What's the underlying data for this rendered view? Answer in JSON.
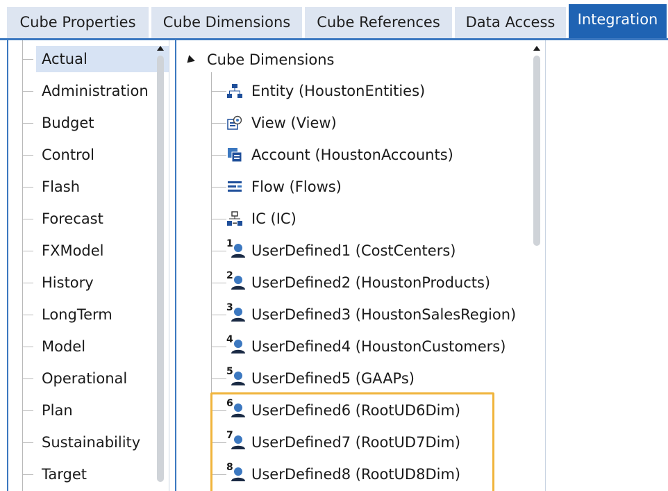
{
  "tabs": [
    {
      "label": "Cube Properties"
    },
    {
      "label": "Cube Dimensions"
    },
    {
      "label": "Cube References"
    },
    {
      "label": "Data Access"
    },
    {
      "label": "Integration"
    }
  ],
  "active_tab": "Integration",
  "scenario_types": [
    {
      "label": "Actual"
    },
    {
      "label": "Administration"
    },
    {
      "label": "Budget"
    },
    {
      "label": "Control"
    },
    {
      "label": "Flash"
    },
    {
      "label": "Forecast"
    },
    {
      "label": "FXModel"
    },
    {
      "label": "History"
    },
    {
      "label": "LongTerm"
    },
    {
      "label": "Model"
    },
    {
      "label": "Operational"
    },
    {
      "label": "Plan"
    },
    {
      "label": "Sustainability"
    },
    {
      "label": "Target"
    }
  ],
  "selected_scenario_type": "Actual",
  "dimension_tree": {
    "root_label": "Cube Dimensions",
    "items": [
      {
        "label": "Entity  (HoustonEntities)",
        "icon": "entity-icon"
      },
      {
        "label": "View  (View)",
        "icon": "view-icon"
      },
      {
        "label": "Account  (HoustonAccounts)",
        "icon": "account-icon"
      },
      {
        "label": "Flow  (Flows)",
        "icon": "flow-icon"
      },
      {
        "label": "IC  (IC)",
        "icon": "ic-icon"
      },
      {
        "label": "UserDefined1  (CostCenters)",
        "icon": "user-defined-icon",
        "num": "1"
      },
      {
        "label": "UserDefined2  (HoustonProducts)",
        "icon": "user-defined-icon",
        "num": "2"
      },
      {
        "label": "UserDefined3  (HoustonSalesRegion)",
        "icon": "user-defined-icon",
        "num": "3"
      },
      {
        "label": "UserDefined4  (HoustonCustomers)",
        "icon": "user-defined-icon",
        "num": "4"
      },
      {
        "label": "UserDefined5  (GAAPs)",
        "icon": "user-defined-icon",
        "num": "5"
      },
      {
        "label": "UserDefined6  (RootUD6Dim)",
        "icon": "user-defined-icon",
        "num": "6"
      },
      {
        "label": "UserDefined7  (RootUD7Dim)",
        "icon": "user-defined-icon",
        "num": "7"
      },
      {
        "label": "UserDefined8  (RootUD8Dim)",
        "icon": "user-defined-icon",
        "num": "8"
      }
    ]
  },
  "colors": {
    "tab_bg": "#dde5f1",
    "tab_active_bg": "#1f63b3",
    "accent_blue": "#3c78c0",
    "selection_bg": "#d7e3f4",
    "highlight_border": "#f0b43c"
  }
}
